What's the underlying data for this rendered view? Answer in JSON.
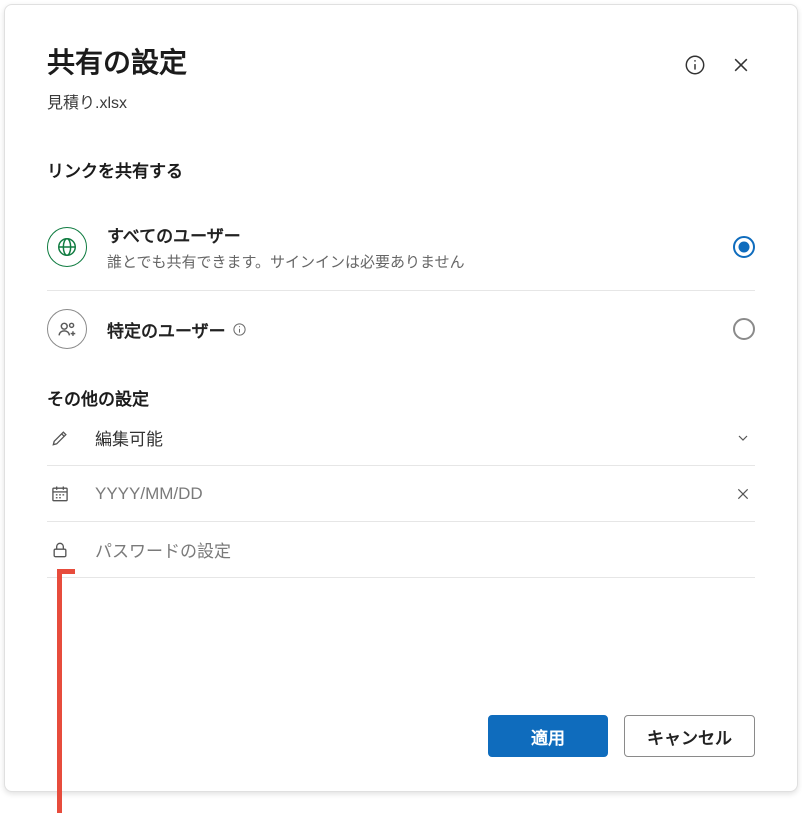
{
  "header": {
    "title": "共有の設定",
    "filename": "見積り.xlsx"
  },
  "share": {
    "section_label": "リンクを共有する",
    "options": {
      "everyone": {
        "title": "すべてのユーザー",
        "subtitle": "誰とでも共有できます。サインインは必要ありません"
      },
      "specific": {
        "title": "特定のユーザー"
      }
    },
    "selected": "everyone"
  },
  "other": {
    "section_label": "その他の設定",
    "permission_label": "編集可能",
    "date_placeholder": "YYYY/MM/DD",
    "date_value": "",
    "password_placeholder": "パスワードの設定",
    "password_value": ""
  },
  "footer": {
    "apply": "適用",
    "cancel": "キャンセル"
  }
}
